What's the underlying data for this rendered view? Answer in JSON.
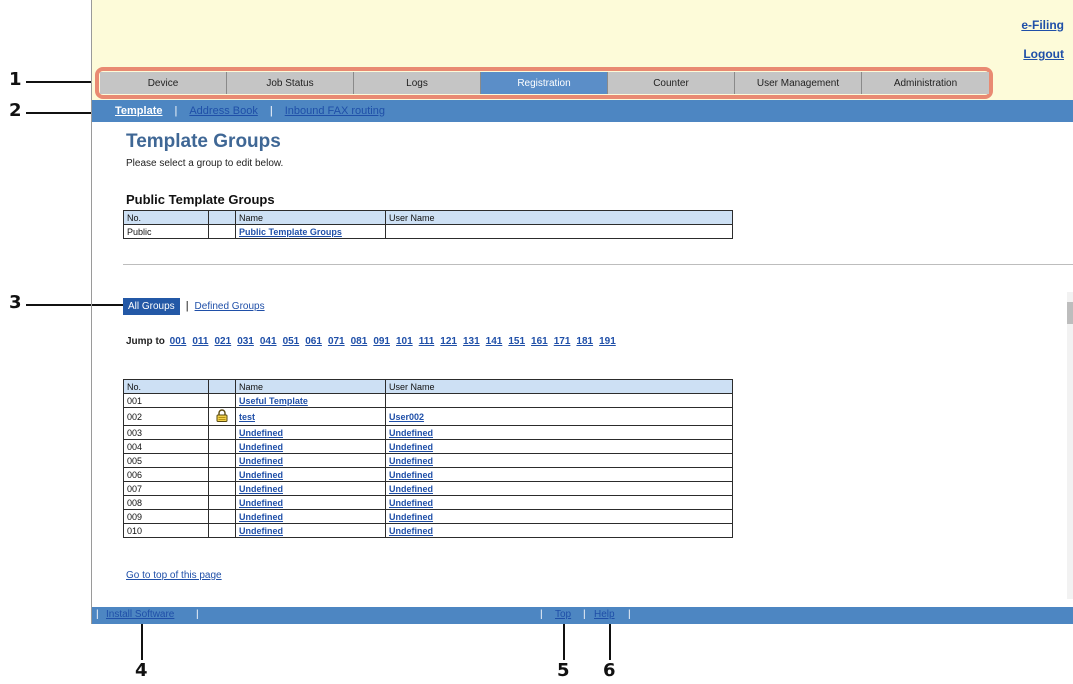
{
  "header": {
    "efiling_label": "e-Filing",
    "logout_label": "Logout"
  },
  "tabs": [
    {
      "label": "Device"
    },
    {
      "label": "Job Status"
    },
    {
      "label": "Logs"
    },
    {
      "label": "Registration"
    },
    {
      "label": "Counter"
    },
    {
      "label": "User Management"
    },
    {
      "label": "Administration"
    }
  ],
  "active_tab": "Registration",
  "subnav": {
    "template": "Template",
    "address_book": "Address Book",
    "inbound_fax": "Inbound FAX routing",
    "separator": "|"
  },
  "page": {
    "title": "Template Groups",
    "instruction": "Please select a group to edit below.",
    "public_heading": "Public Template Groups"
  },
  "columns": {
    "no": "No.",
    "name": "Name",
    "user_name": "User Name"
  },
  "public_table": {
    "no": "Public",
    "name": "Public Template Groups",
    "user": ""
  },
  "filter": {
    "all_groups": "All Groups",
    "separator": "|",
    "defined_groups": "Defined Groups"
  },
  "jump": {
    "label": "Jump to",
    "links": [
      "001",
      "011",
      "021",
      "031",
      "041",
      "051",
      "061",
      "071",
      "081",
      "091",
      "101",
      "111",
      "121",
      "131",
      "141",
      "151",
      "161",
      "171",
      "181",
      "191"
    ]
  },
  "groups": [
    {
      "no": "001",
      "locked": false,
      "name": "Useful Template",
      "user": ""
    },
    {
      "no": "002",
      "locked": true,
      "name": "test",
      "user": "User002"
    },
    {
      "no": "003",
      "locked": false,
      "name": "Undefined",
      "user": "Undefined"
    },
    {
      "no": "004",
      "locked": false,
      "name": "Undefined",
      "user": "Undefined"
    },
    {
      "no": "005",
      "locked": false,
      "name": "Undefined",
      "user": "Undefined"
    },
    {
      "no": "006",
      "locked": false,
      "name": "Undefined",
      "user": "Undefined"
    },
    {
      "no": "007",
      "locked": false,
      "name": "Undefined",
      "user": "Undefined"
    },
    {
      "no": "008",
      "locked": false,
      "name": "Undefined",
      "user": "Undefined"
    },
    {
      "no": "009",
      "locked": false,
      "name": "Undefined",
      "user": "Undefined"
    },
    {
      "no": "010",
      "locked": false,
      "name": "Undefined",
      "user": "Undefined"
    }
  ],
  "goto_top": "Go to top of this page",
  "footer": {
    "install_software": "Install Software",
    "top": "Top",
    "help": "Help",
    "separator": "|"
  },
  "callouts": [
    "1",
    "2",
    "3",
    "4",
    "5",
    "6"
  ],
  "colors": {
    "tab_active": "#5b8ec8",
    "tab_inactive": "#c5c5c5",
    "band": "#4d86c2",
    "highlight": "#e98a72",
    "header_bg": "#fdfbd9",
    "title": "#3f6795",
    "link": "#1f4fa8"
  }
}
